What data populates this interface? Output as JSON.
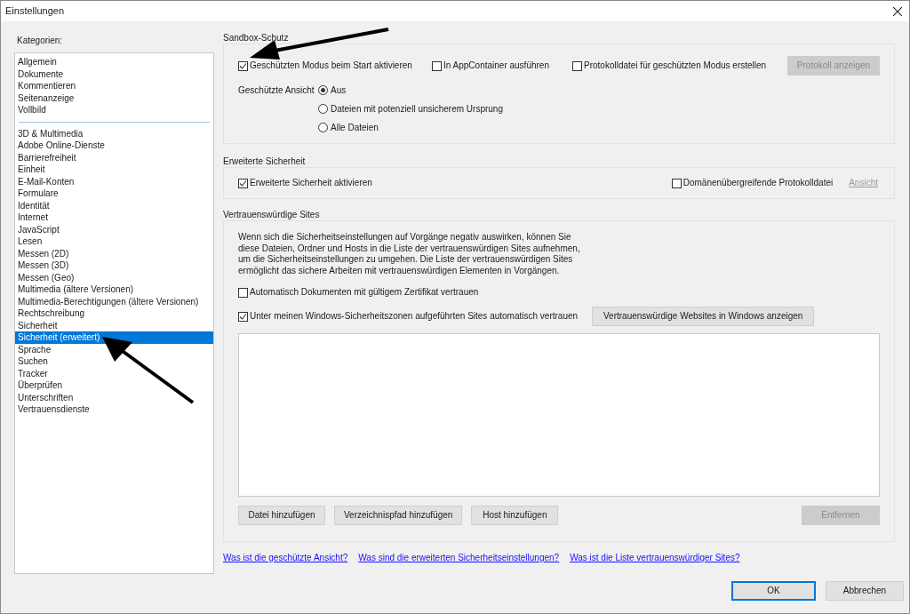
{
  "window": {
    "title": "Einstellungen"
  },
  "categories": {
    "label": "Kategorien:",
    "groups": [
      {
        "items": [
          {
            "label": "Allgemein",
            "selected": false
          },
          {
            "label": "Dokumente",
            "selected": false
          },
          {
            "label": "Kommentieren",
            "selected": false
          },
          {
            "label": "Seitenanzeige",
            "selected": false
          },
          {
            "label": "Vollbild",
            "selected": false
          }
        ]
      },
      {
        "items": [
          {
            "label": "3D & Multimedia",
            "selected": false
          },
          {
            "label": "Adobe Online-Dienste",
            "selected": false
          },
          {
            "label": "Barrierefreiheit",
            "selected": false
          },
          {
            "label": "Einheit",
            "selected": false
          },
          {
            "label": "E-Mail-Konten",
            "selected": false
          },
          {
            "label": "Formulare",
            "selected": false
          },
          {
            "label": "Identität",
            "selected": false
          },
          {
            "label": "Internet",
            "selected": false
          },
          {
            "label": "JavaScript",
            "selected": false
          },
          {
            "label": "Lesen",
            "selected": false
          },
          {
            "label": "Messen (2D)",
            "selected": false
          },
          {
            "label": "Messen (3D)",
            "selected": false
          },
          {
            "label": "Messen (Geo)",
            "selected": false
          },
          {
            "label": "Multimedia (ältere Versionen)",
            "selected": false
          },
          {
            "label": "Multimedia-Berechtigungen (ältere Versionen)",
            "selected": false
          },
          {
            "label": "Rechtschreibung",
            "selected": false
          },
          {
            "label": "Sicherheit",
            "selected": false
          },
          {
            "label": "Sicherheit (erweitert)",
            "selected": true
          },
          {
            "label": "Sprache",
            "selected": false
          },
          {
            "label": "Suchen",
            "selected": false
          },
          {
            "label": "Tracker",
            "selected": false
          },
          {
            "label": "Überprüfen",
            "selected": false
          },
          {
            "label": "Unterschriften",
            "selected": false
          },
          {
            "label": "Vertrauensdienste",
            "selected": false
          }
        ]
      }
    ]
  },
  "sandbox": {
    "title": "Sandbox-Schutz",
    "checkboxes": [
      {
        "label": "Geschützten Modus beim Start aktivieren",
        "checked": true
      },
      {
        "label": "In AppContainer ausführen",
        "checked": false
      },
      {
        "label": "Protokolldatei für geschützten Modus erstellen",
        "checked": false
      }
    ],
    "button": {
      "label": "Protokoll anzeigen",
      "disabled": true
    },
    "protected_view": {
      "label": "Geschützte Ansicht",
      "options": [
        {
          "label": "Aus",
          "selected": true
        },
        {
          "label": "Dateien mit potenziell unsicherem Ursprung",
          "selected": false
        },
        {
          "label": "Alle Dateien",
          "selected": false
        }
      ]
    }
  },
  "enhanced": {
    "title": "Erweiterte Sicherheit",
    "checkboxes": [
      {
        "label": "Erweiterte Sicherheit aktivieren",
        "checked": true
      },
      {
        "label": "Domänenübergreifende Protokolldatei",
        "checked": false
      }
    ],
    "link": {
      "label": "Ansicht",
      "disabled": true
    }
  },
  "trusted": {
    "title": "Vertrauenswürdige Sites",
    "description": "Wenn sich die Sicherheitseinstellungen auf Vorgänge negativ auswirken,  können Sie diese Dateien, Ordner und Hosts in die Liste der vertrauenswürdigen Sites aufnehmen, um die Sicherheitseinstellungen zu umgehen. Die Liste der vertrauenswürdigen Sites ermöglicht das sichere Arbeiten mit vertrauenswürdigen Elementen in Vorgängen.",
    "checkboxes": [
      {
        "label": "Automatisch Dokumenten mit gültigem Zertifikat vertrauen",
        "checked": false
      },
      {
        "label": "Unter meinen Windows-Sicherheitszonen aufgeführten Sites automatisch vertrauen",
        "checked": true
      }
    ],
    "zones_button": {
      "label": "Vertrauenswürdige Websites in Windows anzeigen",
      "disabled": false
    },
    "buttons": [
      {
        "label": "Datei hinzufügen",
        "disabled": false
      },
      {
        "label": "Verzeichnispfad hinzufügen",
        "disabled": false
      },
      {
        "label": "Host hinzufügen",
        "disabled": false
      }
    ],
    "remove_button": {
      "label": "Entfernen",
      "disabled": true
    }
  },
  "help_links": [
    "Was ist die geschützte Ansicht?",
    "Was sind die erweiterten Sicherheitseinstellungen?",
    "Was ist die Liste vertrauenswürdiger Sites?"
  ],
  "footer_buttons": [
    {
      "label": "OK",
      "default": true
    },
    {
      "label": "Abbrechen",
      "default": false
    }
  ]
}
